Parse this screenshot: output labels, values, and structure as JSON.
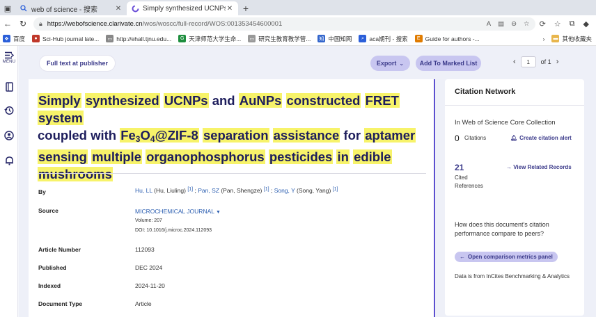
{
  "tabs": [
    {
      "label": "web of science - 搜索",
      "active": false
    },
    {
      "label": "Simply synthesized UCNPs and Au",
      "active": true
    }
  ],
  "address_bar": {
    "url_host": "https://webofscience.clarivate.cn",
    "url_path": "/wos/woscc/full-record/WOS:001353454600001"
  },
  "bookmarks": [
    {
      "label": "百度",
      "color": "#2b5fd9"
    },
    {
      "label": "Sci-Hub journal late...",
      "color": "#c0392b"
    },
    {
      "label": "http://ehall.tjnu.edu...",
      "color": "#555555"
    },
    {
      "label": "天津师范大学生命...",
      "color": "#1e8e3e"
    },
    {
      "label": "研究生教育教学管...",
      "color": "#777777"
    },
    {
      "label": "中国知网",
      "color": "#3366cc"
    },
    {
      "label": "aca期刊 - 搜索",
      "color": "#2b5fd9"
    },
    {
      "label": "Guide for authors -...",
      "color": "#e07b00"
    }
  ],
  "bookmarks_other": "其他收藏夹",
  "rail": {
    "menu_label": "MENU"
  },
  "toolbar": {
    "full_text": "Full text at publisher",
    "export": "Export",
    "add_marked": "Add To Marked List",
    "page_current": "1",
    "page_total": "of 1"
  },
  "record": {
    "title_parts": [
      "Simply",
      "synthesized",
      "UCNPs",
      "and",
      "AuNPs",
      "constructed",
      "FRET",
      "system",
      "coupled",
      "with"
    ],
    "title_formula": {
      "a": "Fe",
      "b": "3",
      "c": "O",
      "d": "4",
      "e": "@ZIF-8"
    },
    "title_rest": [
      "separation",
      "assistance",
      "for",
      "aptamer",
      "sensing",
      "multiple",
      "organophosphorus",
      "pesticides",
      "in",
      "edible",
      "mushrooms"
    ],
    "by_label": "By",
    "authors": [
      {
        "short": "Hu, LL",
        "full": "(Hu, Liuling)",
        "ref": "[1]"
      },
      {
        "short": "Pan, SZ",
        "full": "(Pan, Shengze)",
        "ref": "[1]"
      },
      {
        "short": "Song, Y",
        "full": "(Song, Yang)",
        "ref": "[1]"
      }
    ],
    "source_label": "Source",
    "journal": "MICROCHEMICAL JOURNAL",
    "volume": "Volume: 207",
    "doi": "DOI: 10.1016/j.microc.2024.112093",
    "article_number_label": "Article Number",
    "article_number": "112093",
    "published_label": "Published",
    "published": "DEC 2024",
    "indexed_label": "Indexed",
    "indexed": "2024-11-20",
    "doc_type_label": "Document Type",
    "doc_type": "Article"
  },
  "citation_network": {
    "title": "Citation Network",
    "collection": "In Web of Science Core Collection",
    "citations_count": "0",
    "citations_label": "Citations",
    "create_alert": "Create citation alert",
    "cited_refs_count": "21",
    "cited_refs_label_1": "Cited",
    "cited_refs_label_2": "References",
    "related": "View Related Records",
    "question": "How does this document's citation performance compare to peers?",
    "comparison_button": "Open comparison metrics panel",
    "note": "Data is from InCites Benchmarking & Analytics"
  },
  "colors": {
    "accent": "#3b3a8a",
    "highlight": "#f7f36a",
    "pill": "#c8c6f0",
    "link": "#2a5db0"
  }
}
